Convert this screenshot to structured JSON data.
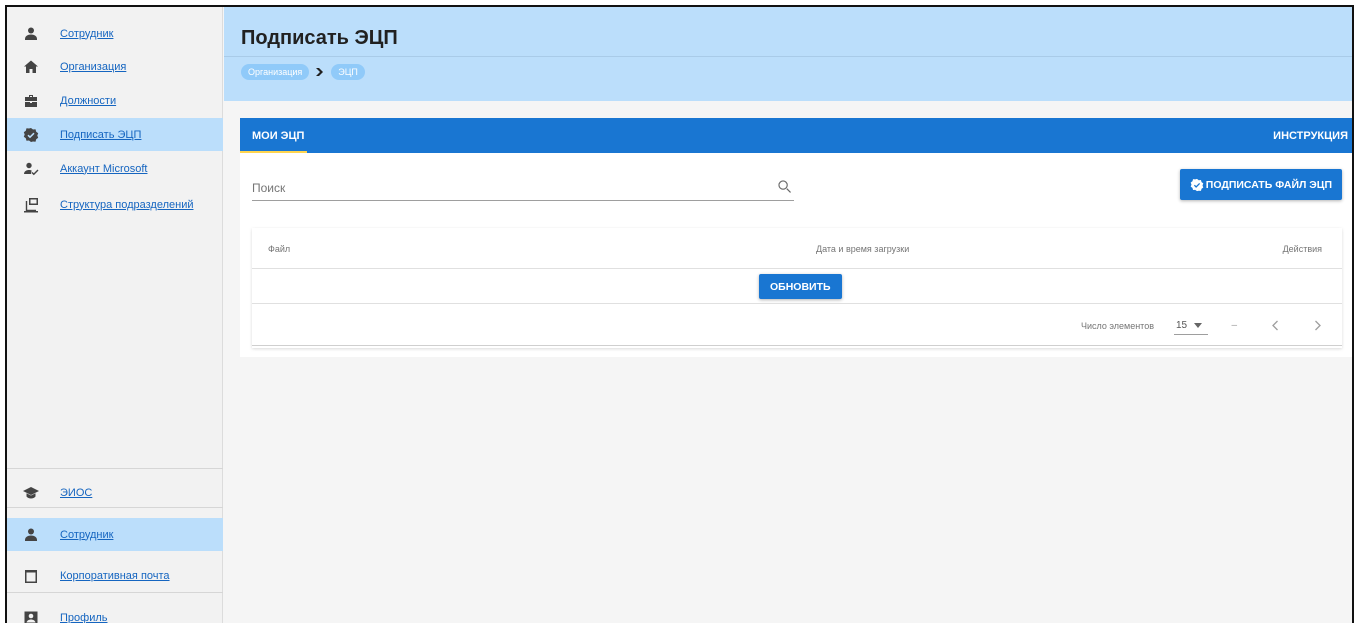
{
  "sidebar": {
    "top_items": [
      {
        "label": "Сотрудник",
        "icon": "person-icon"
      },
      {
        "label": "Организация",
        "icon": "home-icon"
      },
      {
        "label": "Должности",
        "icon": "briefcase-icon"
      },
      {
        "label": "Подписать ЭЦП",
        "icon": "verified-badge-icon",
        "active": true
      },
      {
        "label": "Аккаунт Microsoft",
        "icon": "person-check-icon"
      },
      {
        "label": "Структура подразделений",
        "icon": "hierarchy-icon"
      }
    ],
    "bottom_items": [
      {
        "label": "ЭИОС",
        "icon": "graduation-cap-icon"
      },
      {
        "label": "Сотрудник",
        "icon": "person-icon",
        "active": true
      },
      {
        "label": "Корпоративная почта",
        "icon": "calendar-icon"
      },
      {
        "label": "Профиль",
        "icon": "account-box-icon"
      }
    ]
  },
  "header": {
    "title": "Подписать ЭЦП",
    "breadcrumb": [
      "Организация",
      "ЭЦП"
    ]
  },
  "tabs": {
    "mine": "МОИ ЭЦП",
    "instruction": "ИНСТРУКЦИЯ"
  },
  "search": {
    "placeholder": "Поиск",
    "value": ""
  },
  "actions": {
    "sign_file": "ПОДПИСАТЬ ФАЙЛ ЭЦП",
    "refresh": "ОБНОВИТЬ"
  },
  "table": {
    "columns": [
      "Файл",
      "Дата и время загрузки",
      "Действия"
    ],
    "rows": []
  },
  "pagination": {
    "label": "Число элементов",
    "page_size": "15",
    "range": "–"
  },
  "colors": {
    "primary": "#1976d2",
    "header_bg": "#bbdefb",
    "active_item_bg": "#bbdefb",
    "tab_indicator": "#ffd54f",
    "link": "#1565c0"
  }
}
